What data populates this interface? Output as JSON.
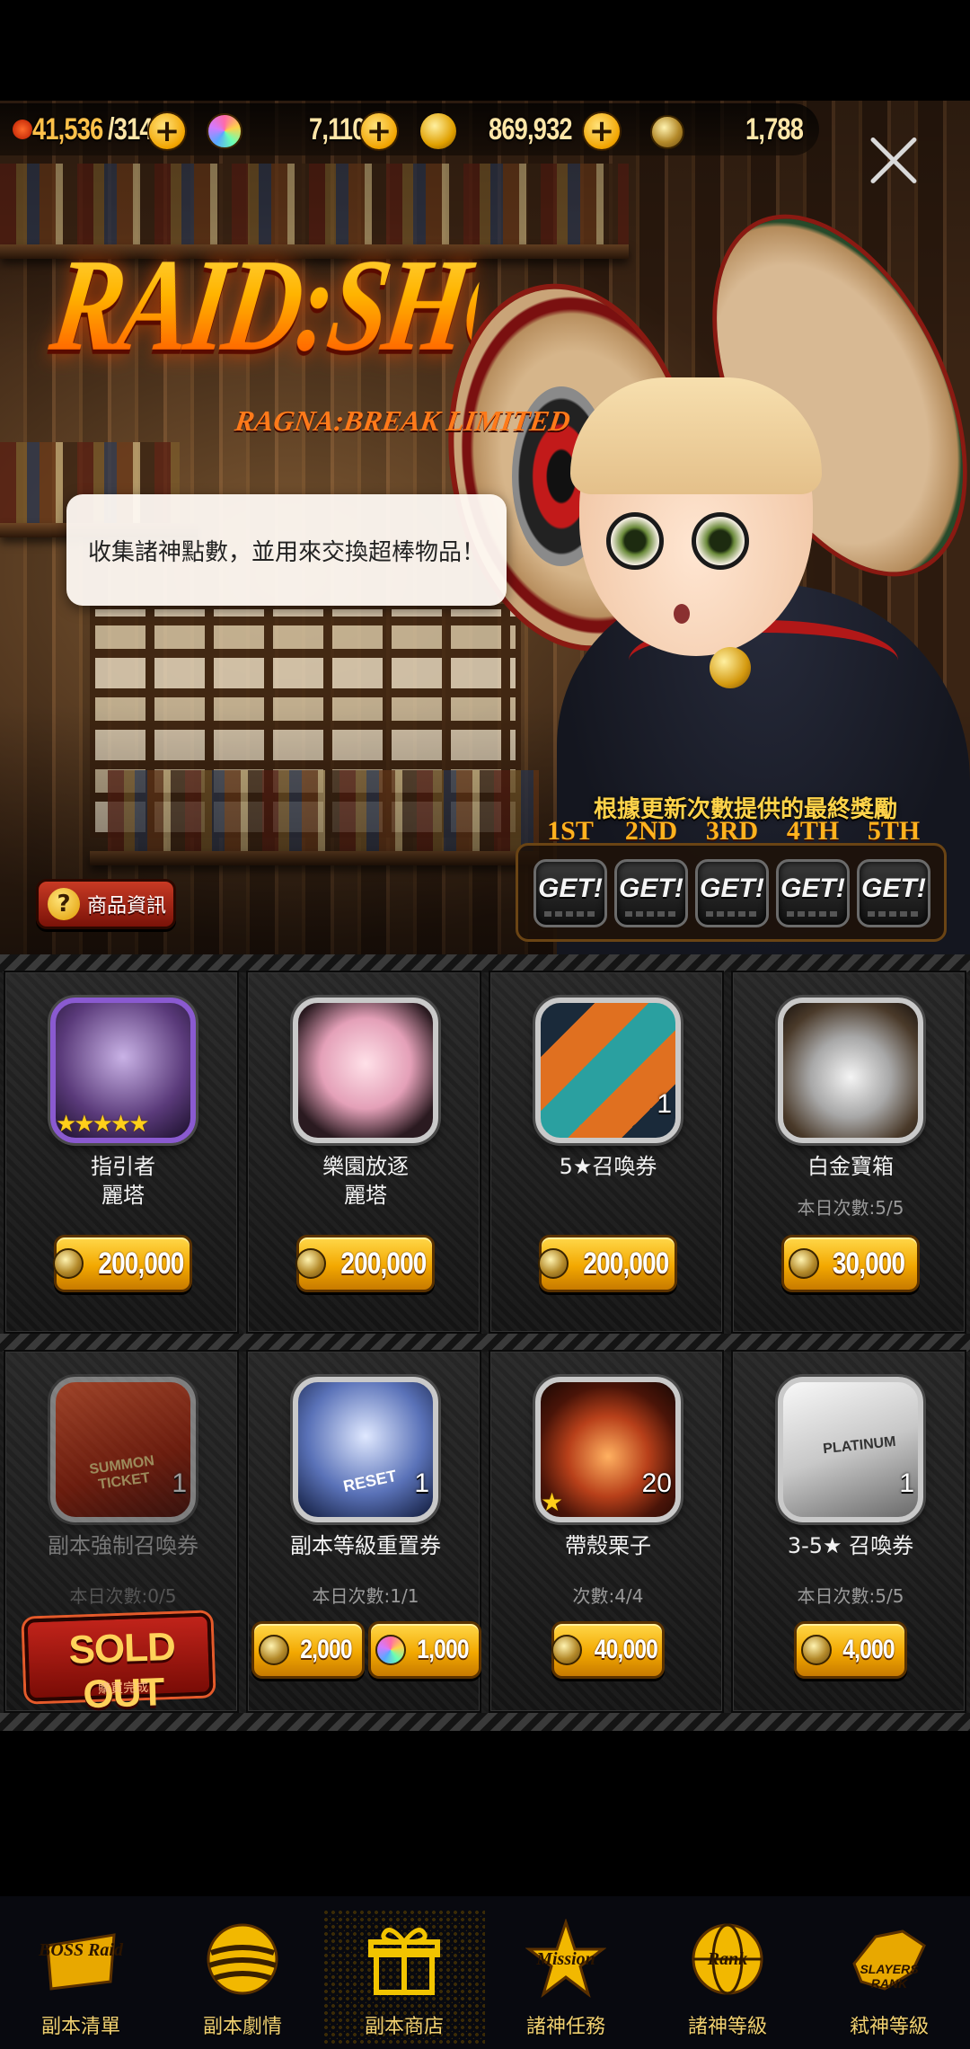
{
  "currency": {
    "stamina": "41,536",
    "stamina_max": "/314",
    "gems": "7,110",
    "gold": "869,932",
    "raid_points": "1,788"
  },
  "hero": {
    "logo_title": "RAID:SHOP",
    "logo_subtitle": "RAGNA:BREAK LIMITED",
    "bubble_text": "收集諸神點數，並用來交換超棒物品！",
    "rewards_title": "根據更新次數提供的最終獎勵",
    "rewards": [
      {
        "rank": "1ST",
        "label": "GET!"
      },
      {
        "rank": "2ND",
        "label": "GET!"
      },
      {
        "rank": "3RD",
        "label": "GET!"
      },
      {
        "rank": "4TH",
        "label": "GET!"
      },
      {
        "rank": "5TH",
        "label": "GET!"
      }
    ],
    "info_button": "商品資訊",
    "info_icon": "?"
  },
  "shop": {
    "items": [
      {
        "name_line1": "指引者",
        "name_line2": "麗塔",
        "stars": "★★★★★",
        "count": "",
        "limit": "",
        "price": "200,000",
        "currency": "raid-point",
        "sold_out": false
      },
      {
        "name_line1": "樂園放逐",
        "name_line2": "麗塔",
        "stars": "",
        "count": "",
        "limit": "",
        "price": "200,000",
        "currency": "raid-point",
        "sold_out": false
      },
      {
        "name_line1": "5★召喚券",
        "name_line2": "",
        "stars": "",
        "count": "1",
        "limit": "",
        "price": "200,000",
        "currency": "raid-point",
        "sold_out": false
      },
      {
        "name_line1": "白金寶箱",
        "name_line2": "",
        "stars": "",
        "count": "",
        "limit": "本日次數:5/5",
        "price": "30,000",
        "currency": "raid-point",
        "sold_out": false
      },
      {
        "name_line1": "副本強制召喚券",
        "name_line2": "",
        "stars": "",
        "count": "1",
        "limit": "本日次數:0/5",
        "price": "",
        "currency": "",
        "sold_out": true
      },
      {
        "name_line1": "副本等級重置券",
        "name_line2": "",
        "stars": "",
        "count": "1",
        "limit": "本日次數:1/1",
        "price": "2,000",
        "price2": "1,000",
        "currency": "raid-point",
        "currency2": "gem",
        "sold_out": false
      },
      {
        "name_line1": "帶殼栗子",
        "name_line2": "",
        "stars": "★",
        "count": "20",
        "limit": "次數:4/4",
        "price": "40,000",
        "currency": "raid-point",
        "sold_out": false
      },
      {
        "name_line1": "3-5★ 召喚券",
        "name_line2": "",
        "stars": "",
        "count": "1",
        "limit": "本日次數:5/5",
        "price": "4,000",
        "currency": "raid-point",
        "sold_out": false
      }
    ],
    "sold_out_label": "SOLD OUT",
    "sold_out_sub": "購買完成",
    "ticket_art_text": "SUMMON TICKET",
    "reset_art_text": "RESET",
    "card_art_text": "PLATINUM"
  },
  "nav": {
    "items": [
      {
        "label": "副本清單",
        "icon_text": "BOSS Raid",
        "icon": "boss-raid-icon"
      },
      {
        "label": "副本劇情",
        "icon_text": "",
        "icon": "story-orb-icon"
      },
      {
        "label": "副本商店",
        "icon_text": "",
        "icon": "gift-box-icon",
        "active": true
      },
      {
        "label": "諸神任務",
        "icon_text": "Mission",
        "icon": "mission-star-icon"
      },
      {
        "label": "諸神等級",
        "icon_text": "Rank",
        "icon": "rank-globe-icon"
      },
      {
        "label": "弒神等級",
        "icon_text": "SLAYERS RANK",
        "icon": "slayers-rank-icon"
      }
    ]
  },
  "colors": {
    "accent_gold": "#f3a800",
    "title_orange": "#ff9a10",
    "sold_out_red": "#c0231a",
    "nav_label": "#f0d070"
  }
}
